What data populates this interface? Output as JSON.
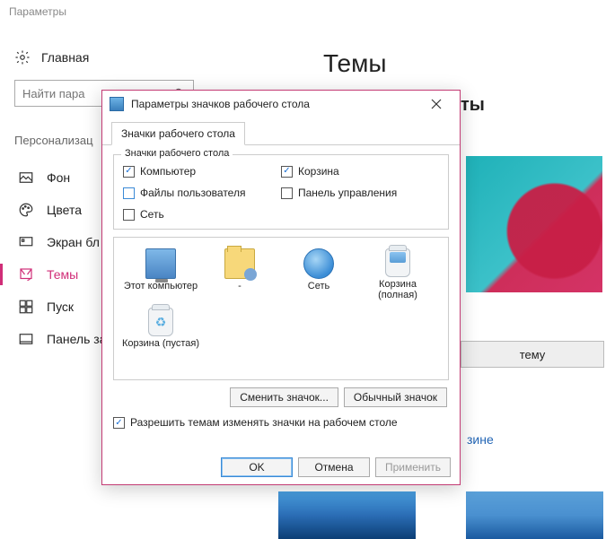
{
  "app_title": "Параметры",
  "sidebar": {
    "home": "Главная",
    "search_placeholder": "Найти пара",
    "section": "Персонализац",
    "items": [
      {
        "label": "Фон"
      },
      {
        "label": "Цвета"
      },
      {
        "label": "Экран бл"
      },
      {
        "label": "Темы"
      },
      {
        "label": "Пуск"
      },
      {
        "label": "Панель за"
      }
    ]
  },
  "page_title": "Темы",
  "right": {
    "heading_fragment": "ты",
    "button_fragment": "тему",
    "link_fragment": "зине"
  },
  "dialog": {
    "title": "Параметры значков рабочего стола",
    "tab": "Значки рабочего стола",
    "group_legend": "Значки рабочего стола",
    "checkboxes": {
      "computer": {
        "label": "Компьютер",
        "checked": true
      },
      "user_files": {
        "label": "Файлы пользователя",
        "checked": false
      },
      "network": {
        "label": "Сеть",
        "checked": false
      },
      "recycle": {
        "label": "Корзина",
        "checked": true
      },
      "control_panel": {
        "label": "Панель управления",
        "checked": false
      }
    },
    "icons": [
      {
        "label": "Этот компьютер"
      },
      {
        "label": "-"
      },
      {
        "label": "Сеть"
      },
      {
        "label": "Корзина (полная)"
      },
      {
        "label": "Корзина (пустая)"
      }
    ],
    "change_icon": "Сменить значок...",
    "default_icon": "Обычный значок",
    "allow_themes": "Разрешить темам изменять значки на рабочем столе",
    "allow_checked": true,
    "ok": "OK",
    "cancel": "Отмена",
    "apply": "Применить"
  }
}
